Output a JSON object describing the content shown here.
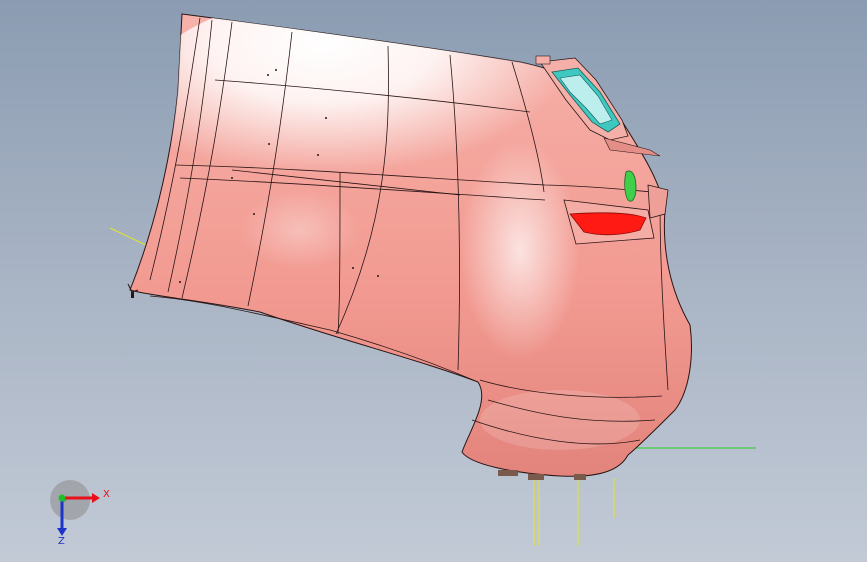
{
  "triad": {
    "x_label": "X",
    "z_label": "Z",
    "x_color": "#e8101a",
    "y_color": "#1fbf2a",
    "z_color": "#1d33c9"
  },
  "model": {
    "body_color": "#f2a29b",
    "highlight_color": "#ffffff",
    "edge_color": "#2a1515",
    "lamp_color": "#ff1a14",
    "vent_color": "#3ec8c0",
    "clip_color": "#3fcf4a",
    "guide_line_color": "#e4e42a",
    "ref_line_color": "#22d022"
  }
}
